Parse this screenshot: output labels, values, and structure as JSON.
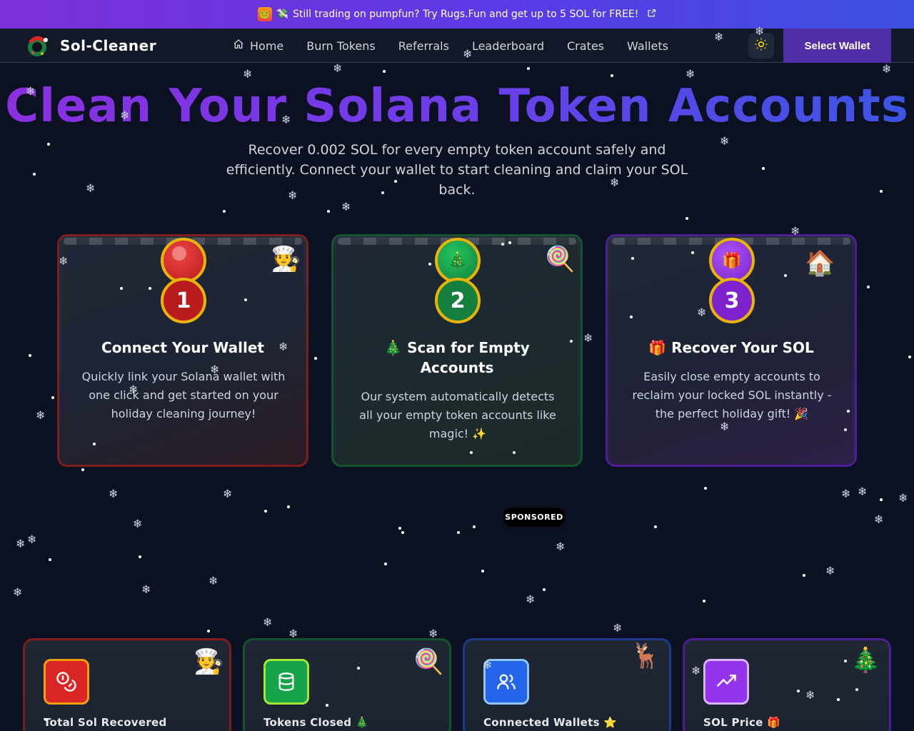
{
  "banner": {
    "emoji": "💸",
    "text": "Still trading on pumpfun? Try Rugs.Fun and get up to 5 SOL for FREE!",
    "app_icon": "rugs-fun-icon",
    "link_icon": "external-link-icon"
  },
  "nav": {
    "brand": "Sol-Cleaner",
    "links": [
      {
        "label": "Home",
        "icon": "home-icon"
      },
      {
        "label": "Burn Tokens"
      },
      {
        "label": "Referrals"
      },
      {
        "label": "Leaderboard"
      },
      {
        "label": "Crates"
      },
      {
        "label": "Wallets"
      }
    ],
    "theme_icon": "sun-icon",
    "wallet_button": "Select Wallet"
  },
  "hero": {
    "title": "Clean Your Solana Token Accounts",
    "subtitle": "Recover 0.002 SOL for every empty token account safely and efficiently. Connect your wallet to start cleaning and claim your SOL back."
  },
  "steps": [
    {
      "number": "1",
      "emoji": "",
      "title": "Connect Your Wallet",
      "desc": "Quickly link your Solana wallet with one click and get started on your holiday cleaning journey!",
      "ornament": "",
      "deco": "🧑‍🍳"
    },
    {
      "number": "2",
      "emoji": "🎄",
      "title": "Scan for Empty Accounts",
      "desc": "Our system automatically detects all your empty token accounts like magic! ✨",
      "ornament": "🎄",
      "deco": "🍭"
    },
    {
      "number": "3",
      "emoji": "🎁",
      "title": "Recover Your SOL",
      "desc": "Easily close empty accounts to reclaim your locked SOL instantly - the perfect holiday gift! 🎉",
      "ornament": "🎁",
      "deco": "🏠"
    }
  ],
  "sponsored": "SPONSORED",
  "stats": [
    {
      "label": "Total Sol Recovered",
      "emoji": "",
      "icon": "coins-icon"
    },
    {
      "label": "Tokens Closed",
      "emoji": "🎄",
      "icon": "database-icon"
    },
    {
      "label": "Connected Wallets",
      "emoji": "⭐",
      "icon": "users-icon"
    },
    {
      "label": "SOL Price",
      "emoji": "🎁",
      "icon": "trending-up-icon"
    }
  ],
  "colors": {
    "banner_start": "#7c2fd6",
    "banner_end": "#3b4fe0",
    "wallet_button": "#512da8",
    "title_start": "#8b2fe0",
    "title_end": "#3a55e4",
    "background": "#0b1120"
  }
}
